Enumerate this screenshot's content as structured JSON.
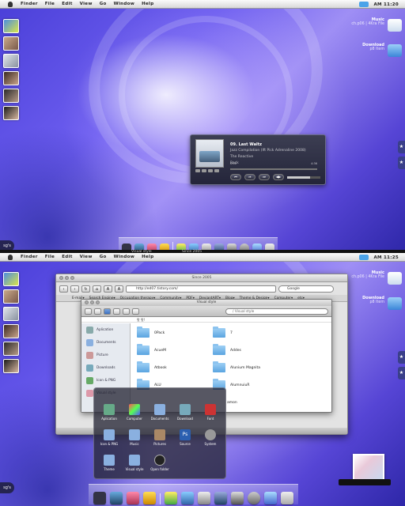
{
  "menubar": {
    "items": [
      "Finder",
      "File",
      "Edit",
      "View",
      "Go",
      "Window",
      "Help"
    ],
    "time_top": "AM 11:20",
    "time_bottom": "AM 11:25"
  },
  "notifications": [
    {
      "title": "Music",
      "subtitle": "ch.p06 | 4Kra File",
      "icon_color": "#2a6fd0",
      "icon": "megaphone-icon"
    },
    {
      "title": "Download",
      "subtitle": "p8 Item",
      "icon_color": "#5a9fe8",
      "icon": "download-folder-icon"
    }
  ],
  "corner_label": "sg's",
  "player": {
    "track": "09. Last Waltz",
    "album": "Jazz Compilation (Ift Pick Adrenaline 2008)",
    "artist": "The Reactive",
    "genre": "Rock",
    "elapsed": "0:00",
    "remaining": "4:36",
    "progress": 0.0,
    "volume": 0.7,
    "buttons": [
      "⏮",
      "⏯",
      "⏭",
      "◀▶",
      "⤢"
    ]
  },
  "taskbar_top": {
    "left": "Visual style",
    "right": "Since 2005"
  },
  "browser": {
    "title": "Since 2005",
    "url": "http://ed07.tistory.com/",
    "search": "Google",
    "bookmarks": [
      "E-mail▾",
      "Search Engine▾",
      "Occupation therapy▾",
      "Community▾",
      "PDF▾",
      "DeviantART▾",
      "Blog▾",
      "Theme & Design▾",
      "Computer▾",
      "etc▾"
    ]
  },
  "finder": {
    "title": "Visual style",
    "search_path": "/ Visual style",
    "path_label": "팟 팟!",
    "sidebar": [
      {
        "label": "Aplication",
        "color": "#8aa"
      },
      {
        "label": "Documents",
        "color": "#8ab0e0"
      },
      {
        "label": "Picture",
        "color": "#c99"
      },
      {
        "label": "Downloads",
        "color": "#7ab"
      },
      {
        "label": "Icon & PNG",
        "color": "#6a6"
      },
      {
        "label": "Visual style",
        "color": "#d9a"
      }
    ],
    "folders_left": [
      "0Pack",
      "AcueM",
      "Atbook",
      "ALU"
    ],
    "folders_right": [
      "7",
      "Addes",
      "Alunium Magnita",
      "AlumnuiuR"
    ]
  },
  "stack": {
    "row1": [
      "Aplication",
      "Computer",
      "Documents",
      "Download",
      "Font"
    ],
    "row2": [
      "Icon & PNG",
      "Music",
      "Pictures",
      "Source",
      "System"
    ],
    "row3": [
      "Theme",
      "Visual style",
      "Open folder"
    ],
    "partial_label": "amon"
  },
  "colors": {
    "menubar": "#e8e8e8",
    "wallpaper_accent": "#6d5ef0",
    "finder_folder": "#5aa4e0"
  }
}
